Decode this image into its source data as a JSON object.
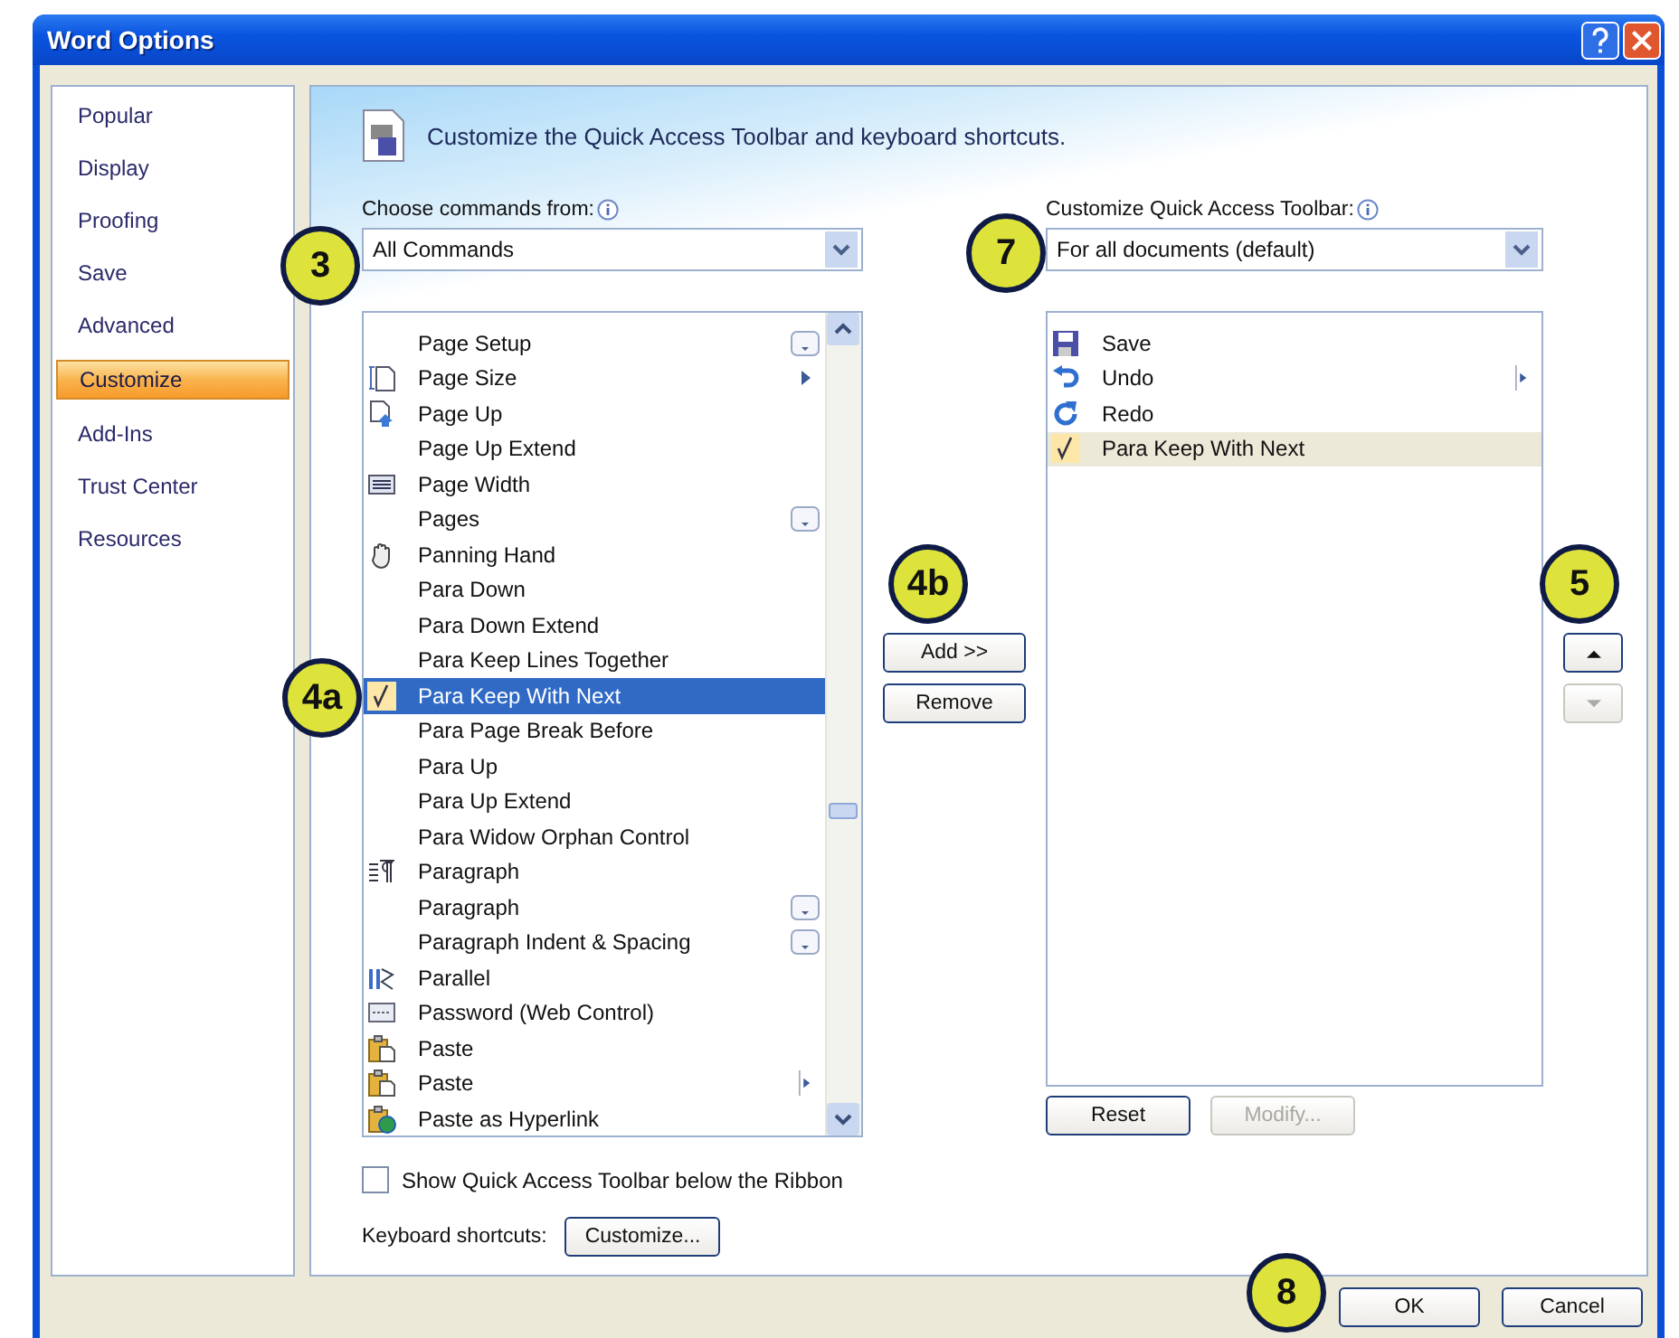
{
  "window": {
    "title": "Word Options"
  },
  "nav": [
    {
      "label": "Popular",
      "selected": false
    },
    {
      "label": "Display",
      "selected": false
    },
    {
      "label": "Proofing",
      "selected": false
    },
    {
      "label": "Save",
      "selected": false
    },
    {
      "label": "Advanced",
      "selected": false
    },
    {
      "label": "Customize",
      "selected": true
    },
    {
      "label": "Add-Ins",
      "selected": false
    },
    {
      "label": "Trust Center",
      "selected": false
    },
    {
      "label": "Resources",
      "selected": false
    }
  ],
  "header": {
    "title": "Customize the Quick Access Toolbar and keyboard shortcuts."
  },
  "commands_from": {
    "label": "Choose commands from:",
    "value": "All Commands",
    "callout": "3"
  },
  "commands": [
    {
      "label": "Page Setup",
      "kind": "gallery",
      "selected": false
    },
    {
      "label": "Page Size",
      "kind": "submenu",
      "selected": false
    },
    {
      "label": "Page Up",
      "kind": "plain",
      "selected": false
    },
    {
      "label": "Page Up Extend",
      "kind": "plain",
      "selected": false
    },
    {
      "label": "Page Width",
      "kind": "plain",
      "selected": false
    },
    {
      "label": "Pages",
      "kind": "gallery",
      "selected": false
    },
    {
      "label": "Panning Hand",
      "kind": "plain",
      "selected": false
    },
    {
      "label": "Para Down",
      "kind": "plain",
      "selected": false
    },
    {
      "label": "Para Down Extend",
      "kind": "plain",
      "selected": false
    },
    {
      "label": "Para Keep Lines Together",
      "kind": "plain",
      "selected": false
    },
    {
      "label": "Para Keep With Next",
      "kind": "plain",
      "selected": true
    },
    {
      "label": "Para Page Break Before",
      "kind": "plain",
      "selected": false
    },
    {
      "label": "Para Up",
      "kind": "plain",
      "selected": false
    },
    {
      "label": "Para Up Extend",
      "kind": "plain",
      "selected": false
    },
    {
      "label": "Para Widow Orphan Control",
      "kind": "plain",
      "selected": false
    },
    {
      "label": "Paragraph",
      "kind": "plain",
      "selected": false
    },
    {
      "label": "Paragraph",
      "kind": "gallery",
      "selected": false
    },
    {
      "label": "Paragraph Indent & Spacing",
      "kind": "gallery",
      "selected": false
    },
    {
      "label": "Parallel",
      "kind": "plain",
      "selected": false
    },
    {
      "label": "Password (Web Control)",
      "kind": "plain",
      "selected": false
    },
    {
      "label": "Paste",
      "kind": "plain",
      "selected": false
    },
    {
      "label": "Paste",
      "kind": "split",
      "selected": false
    },
    {
      "label": "Paste as Hyperlink",
      "kind": "plain",
      "selected": false
    }
  ],
  "commands_callout": "4a",
  "move_buttons": {
    "callout": "4b",
    "add": "Add >>",
    "remove": "Remove"
  },
  "toolbar_for": {
    "label": "Customize Quick Access Toolbar:",
    "value": "For all documents (default)",
    "callout": "7"
  },
  "toolbar_items": [
    {
      "label": "Save",
      "kind": "plain",
      "selected": false
    },
    {
      "label": "Undo",
      "kind": "split",
      "selected": false
    },
    {
      "label": "Redo",
      "kind": "plain",
      "selected": false
    },
    {
      "label": "Para Keep With Next",
      "kind": "plain",
      "selected": true
    }
  ],
  "order_buttons": {
    "callout": "5",
    "up_disabled": false,
    "down_disabled": true
  },
  "list_buttons": [
    {
      "label": "Reset",
      "disabled": false
    },
    {
      "label": "Modify...",
      "disabled": true
    }
  ],
  "show_below_ribbon": {
    "label": "Show Quick Access Toolbar below the Ribbon",
    "checked": false
  },
  "keyboard": {
    "label": "Keyboard shortcuts:",
    "button": "Customize..."
  },
  "footer": {
    "callout": "8",
    "buttons": [
      "OK",
      "Cancel"
    ]
  }
}
